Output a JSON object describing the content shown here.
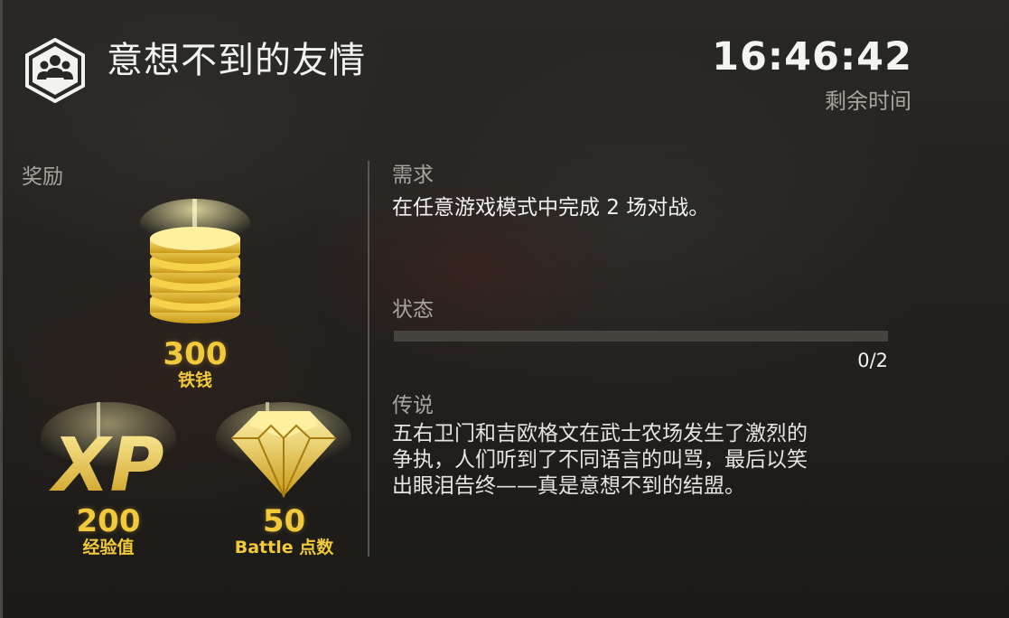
{
  "event": {
    "title": "意想不到的友情",
    "icon": "friends-group-icon"
  },
  "timer": {
    "value": "16:46:42",
    "label": "剩余时间"
  },
  "rewards": {
    "label": "奖励",
    "items": [
      {
        "amount": "300",
        "unit": "铁钱",
        "icon": "iron-coins-icon"
      },
      {
        "amount": "200",
        "unit": "经验值",
        "icon": "xp-icon",
        "icon_text": "XP"
      },
      {
        "amount": "50",
        "unit": "Battle 点数",
        "icon": "diamond-icon"
      }
    ]
  },
  "requirement": {
    "label": "需求",
    "text": "在任意游戏模式中完成 2 场对战。"
  },
  "status": {
    "label": "状态",
    "progress_text": "0/2",
    "progress_fraction": 0
  },
  "lore": {
    "label": "传说",
    "lines": [
      "五右卫门和吉欧格文在武士农场发生了激烈的",
      "争执，人们听到了不同语言的叫骂，最后以笑",
      "出眼泪告终——真是意想不到的结盟。"
    ]
  },
  "colors": {
    "gold": "#f1c93a",
    "muted_label": "#a7a49e",
    "text": "#f2f2f0"
  }
}
